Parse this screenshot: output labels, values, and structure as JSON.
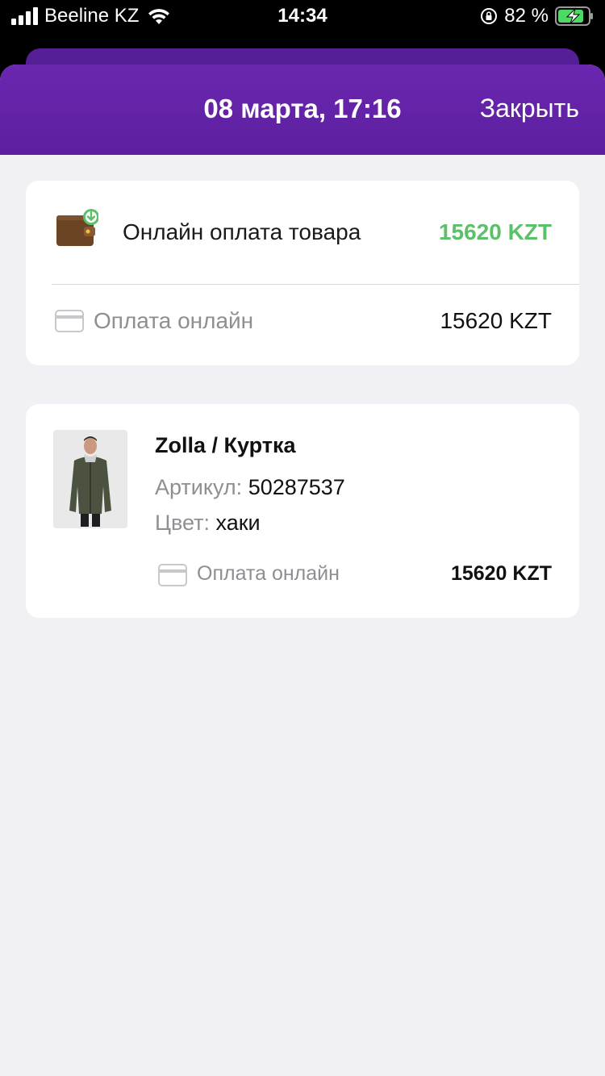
{
  "status_bar": {
    "carrier": "Beeline KZ",
    "time": "14:34",
    "battery": "82 %",
    "icons": [
      "signal-icon",
      "wifi-icon",
      "orientation-lock-icon",
      "battery-charging-icon"
    ]
  },
  "header": {
    "title": "08 марта, 17:16",
    "close_label": "Закрыть",
    "color": "#6a27b0"
  },
  "payment_card": {
    "icon": "wallet-icon",
    "title": "Онлайн оплата товара",
    "amount": "15620 KZT",
    "amount_color": "#5cbf6a",
    "method": {
      "icon": "credit-card-icon",
      "label": "Оплата онлайн",
      "amount": "15620 KZT"
    }
  },
  "product_card": {
    "image": "jacket-photo",
    "title": "Zolla / Куртка",
    "article_key": "Артикул:",
    "article_value": "50287537",
    "color_key": "Цвет:",
    "color_value": "хаки",
    "method": {
      "icon": "credit-card-icon",
      "label": "Оплата онлайн",
      "amount": "15620 KZT"
    }
  }
}
